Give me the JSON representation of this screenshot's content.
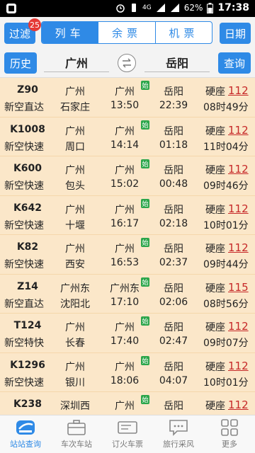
{
  "status": {
    "network": "4G",
    "battery": "62%",
    "time": "17:38"
  },
  "topbar": {
    "filter_label": "过滤",
    "filter_badge": "25",
    "tabs": [
      "列车",
      "余票",
      "机票"
    ],
    "date_label": "日期"
  },
  "stations": {
    "history_label": "历史",
    "from": "广州",
    "to": "岳阳",
    "query_label": "查询"
  },
  "begin_badge": "始",
  "trains": [
    {
      "no": "Z90",
      "type": "新空直达",
      "from": "广州",
      "to": "石家庄",
      "start": "广州",
      "dep": "13:50",
      "end": "岳阳",
      "arr": "22:39",
      "seat": "硬座",
      "price": "112",
      "dur": "08时49分"
    },
    {
      "no": "K1008",
      "type": "新空快速",
      "from": "广州",
      "to": "周口",
      "start": "广州",
      "dep": "14:14",
      "end": "岳阳",
      "arr": "01:18",
      "seat": "硬座",
      "price": "112",
      "dur": "11时04分"
    },
    {
      "no": "K600",
      "type": "新空快速",
      "from": "广州",
      "to": "包头",
      "start": "广州",
      "dep": "15:02",
      "end": "岳阳",
      "arr": "00:48",
      "seat": "硬座",
      "price": "112",
      "dur": "09时46分"
    },
    {
      "no": "K642",
      "type": "新空快速",
      "from": "广州",
      "to": "十堰",
      "start": "广州",
      "dep": "16:17",
      "end": "岳阳",
      "arr": "02:18",
      "seat": "硬座",
      "price": "112",
      "dur": "10时01分"
    },
    {
      "no": "K82",
      "type": "新空快速",
      "from": "广州",
      "to": "西安",
      "start": "广州",
      "dep": "16:53",
      "end": "岳阳",
      "arr": "02:37",
      "seat": "硬座",
      "price": "112",
      "dur": "09时44分"
    },
    {
      "no": "Z14",
      "type": "新空直达",
      "from": "广州东",
      "to": "沈阳北",
      "start": "广州东",
      "dep": "17:10",
      "end": "岳阳",
      "arr": "02:06",
      "seat": "硬座",
      "price": "115",
      "dur": "08时56分"
    },
    {
      "no": "T124",
      "type": "新空特快",
      "from": "广州",
      "to": "长春",
      "start": "广州",
      "dep": "17:40",
      "end": "岳阳",
      "arr": "02:47",
      "seat": "硬座",
      "price": "112",
      "dur": "09时07分"
    },
    {
      "no": "K1296",
      "type": "新空快速",
      "from": "广州",
      "to": "银川",
      "start": "广州",
      "dep": "18:06",
      "end": "岳阳",
      "arr": "04:07",
      "seat": "硬座",
      "price": "112",
      "dur": "10时01分"
    },
    {
      "no": "K238",
      "type": "",
      "from": "深圳西",
      "to": "",
      "start": "广州",
      "dep": "",
      "end": "岳阳",
      "arr": "",
      "seat": "硬座",
      "price": "112",
      "dur": ""
    }
  ],
  "nav": [
    {
      "label": "站站查询",
      "icon": "train-icon"
    },
    {
      "label": "车次车站",
      "icon": "briefcase-icon"
    },
    {
      "label": "订火车票",
      "icon": "ticket-icon"
    },
    {
      "label": "旅行采风",
      "icon": "chat-icon"
    },
    {
      "label": "更多",
      "icon": "grid-icon"
    }
  ]
}
